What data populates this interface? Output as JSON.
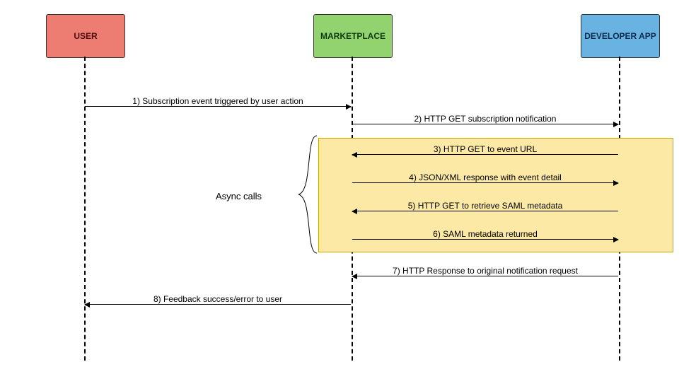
{
  "actors": {
    "user": "USER",
    "marketplace": "MARKETPLACE",
    "developer": "DEVELOPER APP"
  },
  "async_label": "Async calls",
  "steps": {
    "s1": "1) Subscription event triggered by user action",
    "s2": "2) HTTP GET subscription notification",
    "s3": "3) HTTP GET to event URL",
    "s4": "4) JSON/XML response with event detail",
    "s5": "5) HTTP GET to retrieve SAML metadata",
    "s6": "6) SAML metadata returned",
    "s7": "7) HTTP Response to original notification request",
    "s8": "8) Feedback success/error to user"
  },
  "sequence": [
    {
      "from": "user",
      "to": "marketplace",
      "label_key": "s1"
    },
    {
      "from": "marketplace",
      "to": "developer",
      "label_key": "s2"
    },
    {
      "from": "developer",
      "to": "marketplace",
      "label_key": "s3",
      "async": true
    },
    {
      "from": "marketplace",
      "to": "developer",
      "label_key": "s4",
      "async": true
    },
    {
      "from": "developer",
      "to": "marketplace",
      "label_key": "s5",
      "async": true
    },
    {
      "from": "marketplace",
      "to": "developer",
      "label_key": "s6",
      "async": true
    },
    {
      "from": "developer",
      "to": "marketplace",
      "label_key": "s7"
    },
    {
      "from": "marketplace",
      "to": "user",
      "label_key": "s8"
    }
  ]
}
